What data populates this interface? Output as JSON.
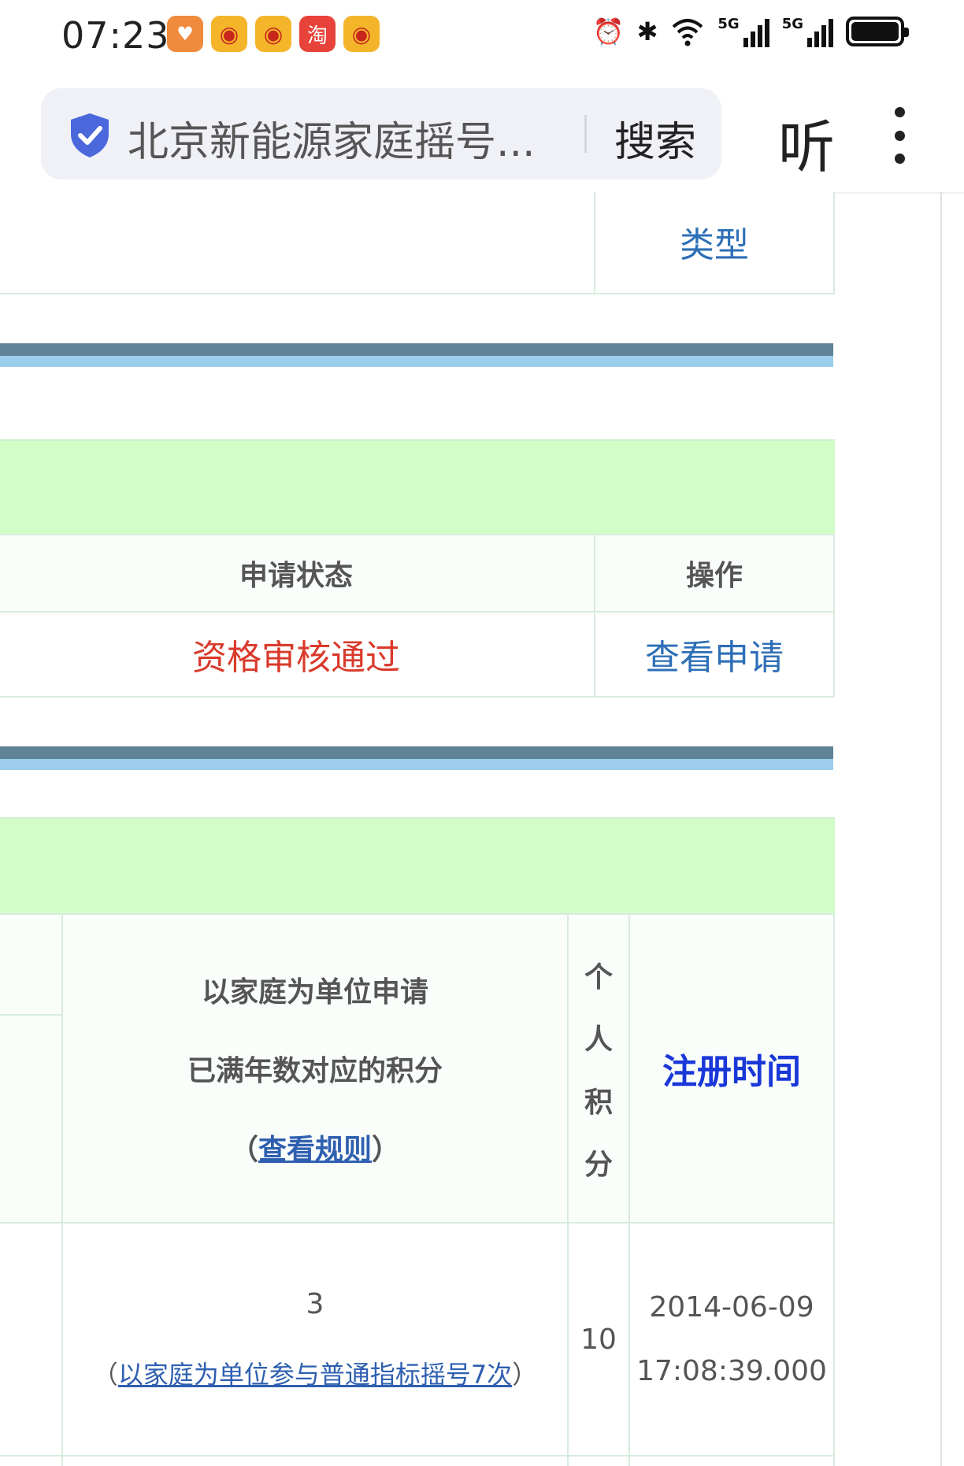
{
  "status_bar": {
    "time": "07:23",
    "notification_icons": [
      "heart-app-icon",
      "weibo-icon",
      "weibo-icon",
      "taobao-icon",
      "weibo-icon"
    ],
    "taobao_char": "淘",
    "network_label_1": "5G",
    "network_label_2": "5G"
  },
  "browser": {
    "search_text": "北京新能源家庭摇号...",
    "search_button": "搜索",
    "listen_button": "听"
  },
  "table1": {
    "type_header": "类型"
  },
  "table2": {
    "status_header": "申请状态",
    "action_header": "操作",
    "status_value": "资格审核通过",
    "action_link": "查看申请"
  },
  "table3": {
    "family_header_line1": "以家庭为单位申请",
    "family_header_line2": "已满年数对应的积分",
    "rule_open": "（",
    "rule_link": "查看规则",
    "rule_close": "）",
    "personal_header_chars": [
      "个",
      "人",
      "积",
      "分"
    ],
    "reg_time_header": "注册时间",
    "family_points": "3",
    "lottery_open": "（",
    "lottery_link": "以家庭为单位参与普通指标摇号7次",
    "lottery_close": "）",
    "personal_points": "10",
    "reg_date": "2014-06-09",
    "reg_time": "17:08:39.000"
  },
  "colors": {
    "link": "#2e6fb7",
    "status_red": "#d93a2b",
    "header_green": "#d3fdc8",
    "bar_dark": "#5f8296",
    "bar_light": "#9dcdec",
    "reg_time_blue": "#1a38d8"
  }
}
